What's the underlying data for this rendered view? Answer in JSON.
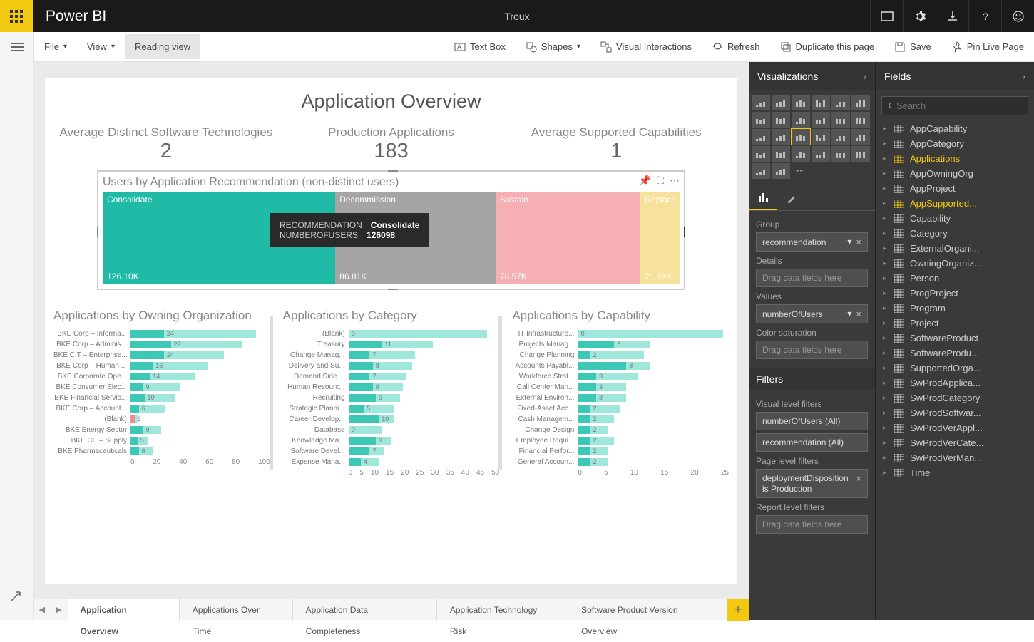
{
  "app": {
    "brand": "Power BI",
    "docTitle": "Troux"
  },
  "ribbon": {
    "file": "File",
    "view": "View",
    "reading": "Reading view",
    "textbox": "Text Box",
    "shapes": "Shapes",
    "visuals": "Visual Interactions",
    "refresh": "Refresh",
    "duplicate": "Duplicate this page",
    "save": "Save",
    "pin": "Pin Live Page"
  },
  "report": {
    "title": "Application Overview",
    "kpi1": {
      "label": "Average Distinct Software Technologies",
      "value": "2"
    },
    "kpi2": {
      "label": "Production Applications",
      "value": "183"
    },
    "kpi3": {
      "label": "Average Supported Capabilities",
      "value": "1"
    },
    "treemap": {
      "title": "Users by Application Recommendation (non-distinct users)",
      "tooltip": {
        "k1": "RECOMMENDATION",
        "v1": "Consolidate",
        "k2": "NUMBEROFUSERS",
        "v2": "126098"
      }
    }
  },
  "chart_data": [
    {
      "type": "treemap",
      "title": "Users by Application Recommendation (non-distinct users)",
      "series": [
        {
          "name": "Consolidate",
          "value": 126098,
          "label": "126.10K",
          "color": "#1FBBA6"
        },
        {
          "name": "Decommission",
          "value": 86810,
          "label": "86.81K",
          "color": "#A5A5A5"
        },
        {
          "name": "Sustain",
          "value": 78570,
          "label": "78.57K",
          "color": "#F6B0B4"
        },
        {
          "name": "Replace",
          "value": 21190,
          "label": "21.19K",
          "color": "#F7E29B"
        }
      ]
    },
    {
      "type": "bar",
      "title": "Applications by Owning Organization",
      "xlim": [
        0,
        100
      ],
      "ticks": [
        0,
        20,
        40,
        60,
        80,
        100
      ],
      "categories": [
        "BKE Corp – Informa...",
        "BKE Corp – Adminis...",
        "BKE CIT – Enterprise...",
        "BKE Corp – Human ...",
        "BKE Corporate Ope...",
        "BKE Consumer Elec...",
        "BKE Financial Servic...",
        "BKE Corp – Account...",
        "(Blank)",
        "BKE Energy Sector",
        "BKE CE – Supply",
        "BKE Pharmaceuticals"
      ],
      "values": [
        24,
        29,
        24,
        16,
        14,
        9,
        10,
        6,
        3,
        9,
        5,
        6
      ],
      "barMax": [
        90,
        80,
        67,
        55,
        46,
        36,
        32,
        25,
        5,
        22,
        13,
        16
      ],
      "highlightIndex": 8
    },
    {
      "type": "bar",
      "title": "Applications by Category",
      "xlim": [
        0,
        50
      ],
      "ticks": [
        0,
        5,
        10,
        15,
        20,
        25,
        30,
        35,
        40,
        45,
        50
      ],
      "categories": [
        "(Blank)",
        "Treasury",
        "Change Manag...",
        "Delivery and Su...",
        "Demand Side ...",
        "Human Resourc...",
        "Recruiting",
        "Strategic Planni...",
        "Career Develop...",
        "Database",
        "Knowledge Ma...",
        "Software Devel...",
        "Expense Mana..."
      ],
      "values": [
        0,
        11,
        7,
        8,
        7,
        8,
        9,
        5,
        10,
        0,
        9,
        7,
        4
      ],
      "barMax": [
        46,
        28,
        22,
        21,
        19,
        18,
        17,
        15,
        15,
        11,
        14,
        12,
        10
      ],
      "highlightIndex": 0
    },
    {
      "type": "bar",
      "title": "Applications by Capability",
      "xlim": [
        0,
        25
      ],
      "ticks": [
        0,
        5,
        10,
        15,
        20,
        25
      ],
      "categories": [
        "IT Infrastructure...",
        "Projects Manag...",
        "Change Planning",
        "Accounts Payabl...",
        "Workforce Strat...",
        "Call Center Man...",
        "External Environ...",
        "Fixed-Asset Acc...",
        "Cash Managem...",
        "Change Design",
        "Employee Requi...",
        "Financial Perfor...",
        "General Accoun..."
      ],
      "values": [
        0,
        6,
        2,
        8,
        3,
        3,
        3,
        2,
        2,
        2,
        2,
        2,
        2
      ],
      "barMax": [
        24,
        12,
        11,
        12,
        10,
        8,
        8,
        7,
        6,
        5,
        6,
        5,
        5
      ],
      "highlightIndex": null
    }
  ],
  "viz": {
    "header": "Visualizations",
    "group": "Group",
    "groupField": "recommendation",
    "details": "Details",
    "dragHint": "Drag data fields here",
    "values": "Values",
    "valueField": "numberOfUsers",
    "colorsat": "Color saturation",
    "filters": "Filters",
    "vlf": "Visual level filters",
    "vlf1": "numberOfUsers (All)",
    "vlf2": "recommendation (All)",
    "plf": "Page level filters",
    "plf1a": "deploymentDisposition",
    "plf1b": "is Production",
    "rlf": "Report level filters"
  },
  "fields": {
    "header": "Fields",
    "searchPlaceholder": "Search",
    "tables": [
      "AppCapability",
      "AppCategory",
      "Applications",
      "AppOwningOrg",
      "AppProject",
      "AppSupported...",
      "Capability",
      "Category",
      "ExternalOrgani...",
      "OwningOrganiz...",
      "Person",
      "ProgProject",
      "Program",
      "Project",
      "SoftwareProduct",
      "SoftwareProdu...",
      "SupportedOrga...",
      "SwProdApplica...",
      "SwProdCategory",
      "SwProdSoftwar...",
      "SwProdVerAppl...",
      "SwProdVerCate...",
      "SwProdVerMan...",
      "Time"
    ],
    "highlighted": [
      "Applications",
      "AppSupported..."
    ]
  },
  "pages": {
    "tabs": [
      "Application Overview",
      "Applications Over Time",
      "Application Data Completeness",
      "Application Technology Risk",
      "Software Product Version Overview"
    ]
  }
}
